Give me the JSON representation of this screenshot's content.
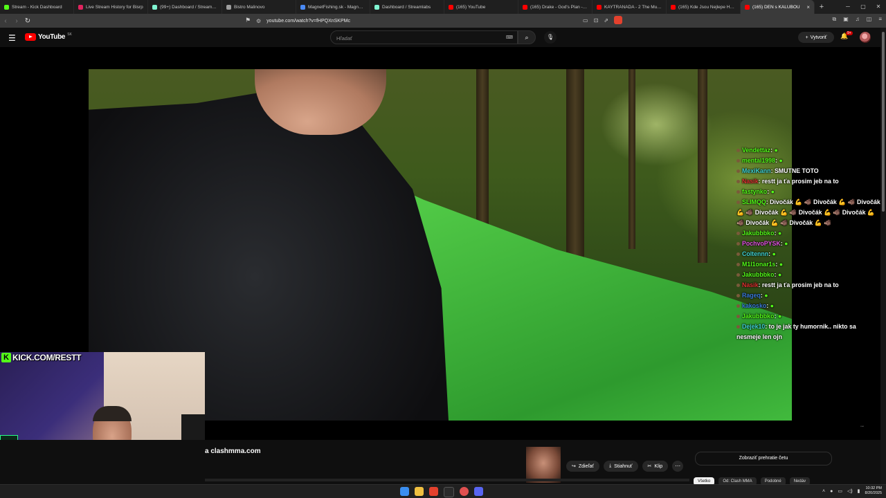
{
  "browser": {
    "tabs": [
      {
        "title": "Stream - Kick Dashboard",
        "color": "#53fc18",
        "active": false
      },
      {
        "title": "Live Stream History for Bisrp",
        "color": "#e0245e",
        "active": false
      },
      {
        "title": "(99+) Dashboard / Streamlabs",
        "color": "#80f5d2",
        "active": false
      },
      {
        "title": "Bistro Malinovo",
        "color": "#9e9e9e",
        "active": false
      },
      {
        "title": "MagnetFishing.sk - Magnety a...",
        "color": "#4a8af4",
        "active": false
      },
      {
        "title": "Dashboard / Streamlabs",
        "color": "#80f5d2",
        "active": false
      },
      {
        "title": "(165) YouTube",
        "color": "#ff0000",
        "active": false
      },
      {
        "title": "(165) Drake - God's Plan - You...",
        "color": "#ff0000",
        "active": false
      },
      {
        "title": "KAYTRANADA - 2 The Music ...",
        "color": "#ff0000",
        "active": false
      },
      {
        "title": "(165) Kde Jsou Nejlepe Hodne...",
        "color": "#ff0000",
        "active": false
      },
      {
        "title": "(165) DEN s KALUBOU",
        "color": "#ff0000",
        "active": true
      }
    ],
    "url": "youtube.com/watch?v=fHPQXnSKPMc"
  },
  "youtube": {
    "logo_text": "YouTube",
    "country_code": "SK",
    "search_placeholder": "Hľadať",
    "create_label": "Vytvoriť",
    "notification_count": "9+"
  },
  "overlay": {
    "kick_text": "KICK.COM/RESTT"
  },
  "chat": [
    {
      "user": "Vendettaz",
      "text": "",
      "color": "#53fc18"
    },
    {
      "user": "mental1998",
      "text": "",
      "color": "#53fc18"
    },
    {
      "user": "MexiKann",
      "text": "SMUTNE TOTO",
      "color": "#3fd0d0"
    },
    {
      "user": "Nasik",
      "text": "restt ja ťa prosim jeb na to",
      "color": "#e03030"
    },
    {
      "user": "fastynko",
      "text": "",
      "color": "#53fc18"
    },
    {
      "user": "SLIMQQ",
      "text": "Divočák 💪 🐗 Divočák 💪 🐗 Divočák 💪 🐗 Divočák 💪 🐗 Divočák 💪 🐗 Divočák 💪 🐗 Divočák 💪 🐗 Divočák 💪 🐗",
      "color": "#53fc18"
    },
    {
      "user": "Jakubbbko",
      "text": "",
      "color": "#53fc18"
    },
    {
      "user": "PochvoPYSK",
      "text": "",
      "color": "#e050e0"
    },
    {
      "user": "Coltennn",
      "text": "",
      "color": "#3fd0d0"
    },
    {
      "user": "M1l1onar1s",
      "text": "",
      "color": "#53fc18"
    },
    {
      "user": "Jakubbbko",
      "text": "",
      "color": "#53fc18"
    },
    {
      "user": "Nasik",
      "text": "restt ja ťa prosim jeb na to",
      "color": "#e03030"
    },
    {
      "user": "Rageq",
      "text": "",
      "color": "#3a7adb"
    },
    {
      "user": "kakosko",
      "text": "",
      "color": "#3a7adb"
    },
    {
      "user": "Jakubbbko",
      "text": "",
      "color": "#53fc18"
    },
    {
      "user": "Dejek10",
      "text": "to je jak ty humornik.. nikto sa nesmeje len ojn",
      "color": "#3fd0d0"
    }
  ],
  "video_info": {
    "title_fragment": "a clashmma.com",
    "actions": [
      {
        "label": "Zdieľať",
        "icon": "share-icon"
      },
      {
        "label": "Stiahnuť",
        "icon": "download-icon"
      },
      {
        "label": "Klip",
        "icon": "scissors-icon"
      }
    ],
    "chat_replay_label": "Zobraziť prehratie četu",
    "chips": [
      "Všetko",
      "Od: Clash MMA",
      "Podobné",
      "Nedáv"
    ]
  },
  "system": {
    "time": "10:32 PM",
    "date": "8/20/2025"
  }
}
